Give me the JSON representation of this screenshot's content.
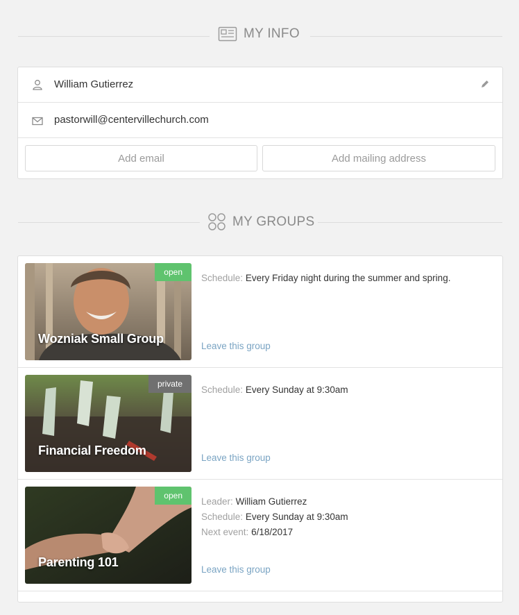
{
  "my_info": {
    "header": "MY INFO",
    "name": "William Gutierrez",
    "email": "pastorwill@centervillechurch.com",
    "add_email_label": "Add email",
    "add_address_label": "Add mailing address"
  },
  "my_groups": {
    "header": "MY GROUPS",
    "groups": [
      {
        "name": "Wozniak Small Group",
        "badge": "open",
        "schedule_key": "Schedule:",
        "schedule": "Every Friday night during the summer and spring.",
        "leave_label": "Leave this group"
      },
      {
        "name": "Financial Freedom",
        "badge": "private",
        "schedule_key": "Schedule:",
        "schedule": "Every Sunday at 9:30am",
        "leave_label": "Leave this group"
      },
      {
        "name": "Parenting 101",
        "badge": "open",
        "leader_key": "Leader:",
        "leader": "William Gutierrez",
        "schedule_key": "Schedule:",
        "schedule": "Every Sunday at 9:30am",
        "next_event_key": "Next event:",
        "next_event": "6/18/2017",
        "leave_label": "Leave this group"
      }
    ]
  },
  "colors": {
    "badge_open": "#5fc36e",
    "badge_private": "#707070",
    "link": "#7aa4c3"
  },
  "icons": [
    "id-card-icon",
    "user-icon",
    "envelope-icon",
    "pencil-icon",
    "groups-icon"
  ]
}
